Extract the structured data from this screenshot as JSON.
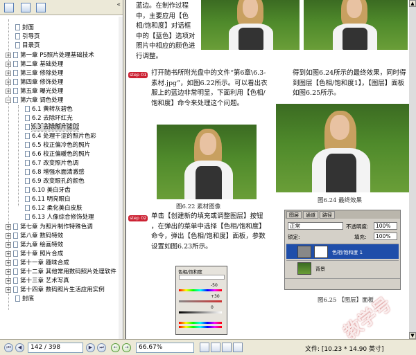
{
  "sidebar": {
    "toolbar_icons": [
      "delete-icon",
      "bookmark-options-icon",
      "export-icon"
    ],
    "items": [
      {
        "label": "封面"
      },
      {
        "label": "引导页"
      },
      {
        "label": "目录页"
      },
      {
        "label": "第一章 PS照片处理基础技术"
      },
      {
        "label": "第二章 基础处理"
      },
      {
        "label": "第三章 修除处理"
      },
      {
        "label": "第四章 修饰处理"
      },
      {
        "label": "第五章 曝光处理"
      },
      {
        "label": "第六章 调色处理"
      },
      {
        "label": "6.1 黄转灰碧色"
      },
      {
        "label": "6.2 去除环红光"
      },
      {
        "label": "6.3 去除照片蓝边"
      },
      {
        "label": "6.4 处理干涩的照片色彩"
      },
      {
        "label": "6.5 校正偏冷色的照片"
      },
      {
        "label": "6.6 校正偏暖色的照片"
      },
      {
        "label": "6.7 改变照片色调"
      },
      {
        "label": "6.8 增强水面清澈感"
      },
      {
        "label": "6.9 改变眼孔的颜色"
      },
      {
        "label": "6.10 美白牙齿"
      },
      {
        "label": "6.11 明亮眼白"
      },
      {
        "label": "6.12 柔化美白皮肤"
      },
      {
        "label": "6.13 人像综合修饰处理"
      },
      {
        "label": "第七章 为照片制作特殊色调"
      },
      {
        "label": "第八章 数码特效"
      },
      {
        "label": "第九章 绘画特效"
      },
      {
        "label": "第十章 照片合成"
      },
      {
        "label": "第十一章 趣味合成"
      },
      {
        "label": "第十二章 其他常用数码照片处理软件"
      },
      {
        "label": "第十三章 艺术写真"
      },
      {
        "label": "第十四章 数码照片生活应用实例"
      },
      {
        "label": "封底"
      }
    ]
  },
  "page": {
    "top_text": "蓝边。在制作过程中，主要应用【色相/饱和度】对话框中的【蓝色】选项对照片中相应的颜色进行调整。",
    "step1_tag": "step 01",
    "step1_text": "打开随书所附光盘中的文件“第6章\\6.3-素材.jpg”，如图6.22所示。可以看出衣服上的蓝边非常明显，下面利用【色相/饱和度】命令来处理这个问题。",
    "result_text": "得到如图6.24所示的最终效果，同时得到图层【色相/饱和度1】，【图层】面板如图6.25所示。",
    "fig22_caption": "图6.22  素材图像",
    "fig24_caption": "图6.24  最终效果",
    "step2_tag": "step 02",
    "step2_text": "单击【创建新的填充或调整图层】按钮 ，在弹出的菜单中选择【色相/饱和度】命令，弹出【色相/饱和度】面板，参数设置如图6.23所示。",
    "fig25_caption": "图6.25  【图层】面板",
    "watermark": "教学号"
  },
  "ps_panel": {
    "tabs": [
      "图层",
      "通道",
      "路径"
    ],
    "blend_mode": "正常",
    "opacity_label": "不透明度:",
    "opacity": "100%",
    "lock_label": "锁定:",
    "fill_label": "填充:",
    "fill": "100%",
    "layers": [
      {
        "name": "色相/饱和度 1"
      },
      {
        "name": "背景"
      }
    ]
  },
  "hs_dialog": {
    "title": "色相/饱和度",
    "values": [
      "-50",
      "+30",
      "0"
    ]
  },
  "statusbar": {
    "page_field": "142 / 398",
    "zoom": "66.67%",
    "file_info": "文件: [10.23 * 14.90 英寸]"
  }
}
